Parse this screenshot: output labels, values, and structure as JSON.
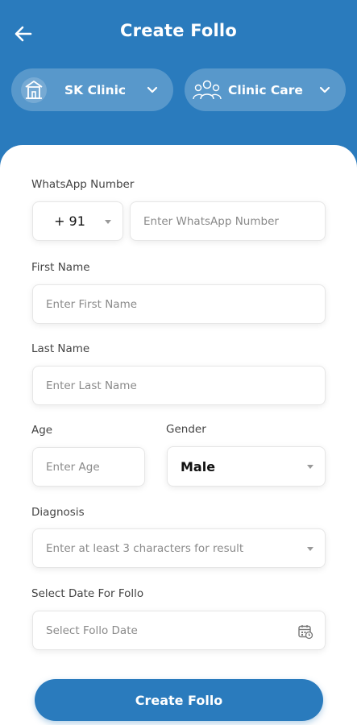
{
  "header": {
    "title": "Create Follo",
    "clinic_selector": {
      "label": "SK Clinic",
      "icon": "building-icon"
    },
    "care_selector": {
      "label": "Clinic Care",
      "icon": "group-icon"
    }
  },
  "form": {
    "whatsapp": {
      "label": "WhatsApp Number",
      "country_code": "+ 91",
      "placeholder": "Enter WhatsApp Number"
    },
    "first_name": {
      "label": "First Name",
      "placeholder": "Enter First Name"
    },
    "last_name": {
      "label": "Last Name",
      "placeholder": "Enter Last Name"
    },
    "age": {
      "label": "Age",
      "placeholder": "Enter Age"
    },
    "gender": {
      "label": "Gender",
      "value": "Male"
    },
    "diagnosis": {
      "label": "Diagnosis",
      "placeholder": "Enter at least 3 characters for result"
    },
    "follo_date": {
      "label": "Select Date For Follo",
      "placeholder": "Select Follo Date",
      "icon": "calendar-icon"
    }
  },
  "footer": {
    "submit_label": "Create Follo"
  },
  "colors": {
    "primary": "#2a7bbd",
    "background": "#ffffff"
  }
}
